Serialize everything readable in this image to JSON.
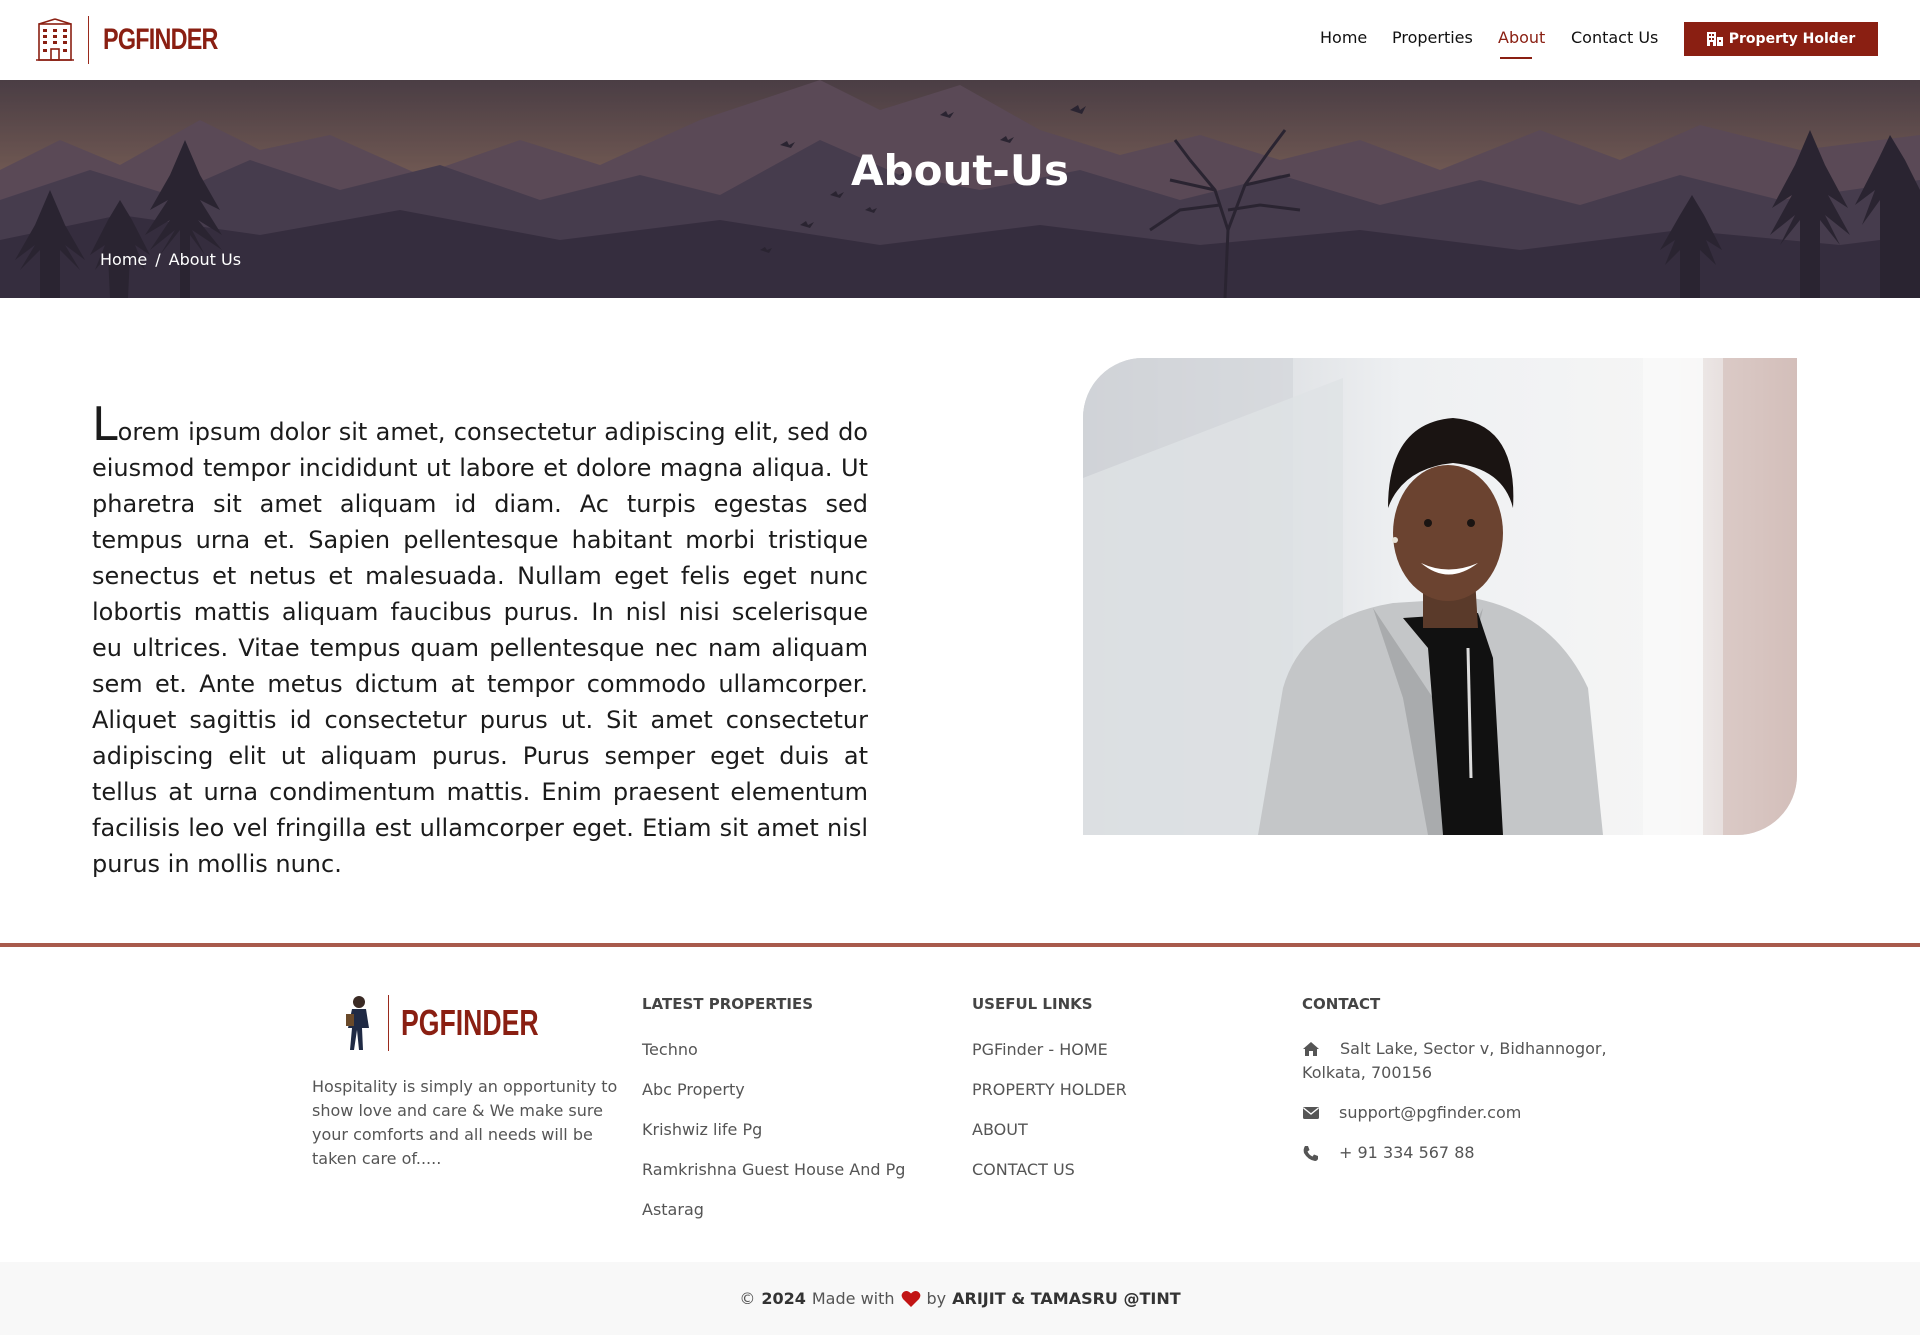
{
  "brand": {
    "name": "PGFINDER",
    "accent": "#8a1f12"
  },
  "nav": {
    "items": [
      {
        "label": "Home"
      },
      {
        "label": "Properties"
      },
      {
        "label": "About"
      },
      {
        "label": "Contact Us"
      }
    ],
    "active": "About",
    "cta_label": "Property Holder",
    "cta_icon": "building-icon"
  },
  "hero": {
    "title": "About-Us",
    "breadcrumb": {
      "home": "Home",
      "separator": "/",
      "current": "About Us"
    }
  },
  "about": {
    "dropcap": "L",
    "text": "orem ipsum dolor sit amet, consectetur adipiscing elit, sed do eiusmod tempor incididunt ut labore et dolore magna aliqua. Ut pharetra sit amet aliquam id diam. Ac turpis egestas sed tempus urna et. Sapien pellentesque habitant morbi tristique senectus et netus et malesuada. Nullam eget felis eget nunc lobortis mattis aliquam faucibus purus. In nisl nisi scelerisque eu ultrices. Vitae tempus quam pellentesque nec nam aliquam sem et. Ante metus dictum at tempor commodo ullamcorper. Aliquet sagittis id consectetur purus ut. Sit amet consectetur adipiscing elit ut aliquam purus. Purus semper eget duis at tellus at urna condimentum mattis. Enim praesent elementum facilisis leo vel fringilla est ullamcorper eget. Etiam sit amet nisl purus in mollis nunc."
  },
  "footer": {
    "brand": "PGFINDER",
    "about": "Hospitality is simply an opportunity to show love and care & We make sure your comforts and all needs will be taken care of.....",
    "latest_title": "LATEST PROPERTIES",
    "latest": [
      {
        "label": "Techno"
      },
      {
        "label": "Abc Property"
      },
      {
        "label": "Krishwiz life Pg"
      },
      {
        "label": "Ramkrishna Guest House And Pg"
      },
      {
        "label": "Astarag"
      }
    ],
    "useful_title": "USEFUL LINKS",
    "useful": [
      {
        "label": "PGFinder - HOME"
      },
      {
        "label": "PROPERTY HOLDER"
      },
      {
        "label": "ABOUT"
      },
      {
        "label": "CONTACT US"
      }
    ],
    "contact_title": "CONTACT",
    "address_line1": "Salt Lake, Sector v, Bidhannogor,",
    "address_line2": "Kolkata, 700156",
    "email": "support@pgfinder.com",
    "phone": "+ 91 334 567 88"
  },
  "copyright": {
    "symbol": "©",
    "year": "2024",
    "made_with": "Made with",
    "by": "by",
    "authors": "ARIJIT & TAMASRU @TINT"
  }
}
